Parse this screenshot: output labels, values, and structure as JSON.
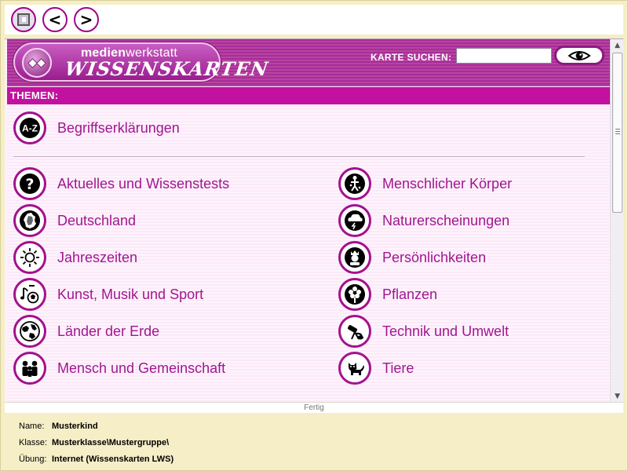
{
  "toolbar": {
    "home_icon": "screen-icon",
    "back_label": "<",
    "forward_label": ">"
  },
  "header": {
    "logo_small_bold": "medien",
    "logo_small_regular": "werkstatt",
    "logo_main": "WISSENSKARTEN",
    "search_label": "KARTE SUCHEN:",
    "search_value": "",
    "search_button_icon": "eye-icon"
  },
  "themen_label": "THEMEN:",
  "topics": {
    "a_z": "Begriffserklärungen",
    "left": [
      "Aktuelles und Wissenstests",
      "Deutschland",
      "Jahreszeiten",
      "Kunst, Musik und Sport",
      "Länder der Erde",
      "Mensch und Gemeinschaft"
    ],
    "right": [
      "Menschlicher Körper",
      "Naturerscheinungen",
      "Persönlichkeiten",
      "Pflanzen",
      "Technik und Umwelt",
      "Tiere"
    ]
  },
  "status_text": "Fertig",
  "info": {
    "name_label": "Name:",
    "name_value": "Musterkind",
    "klasse_label": "Klasse:",
    "klasse_value": "Musterklasse\\Mustergruppe\\",
    "uebung_label": "Übung:",
    "uebung_value": "Internet (Wissenskarten LWS)"
  },
  "colors": {
    "accent": "#c2119f",
    "header": "#a62d9a",
    "text_magenta": "#a0168e"
  }
}
